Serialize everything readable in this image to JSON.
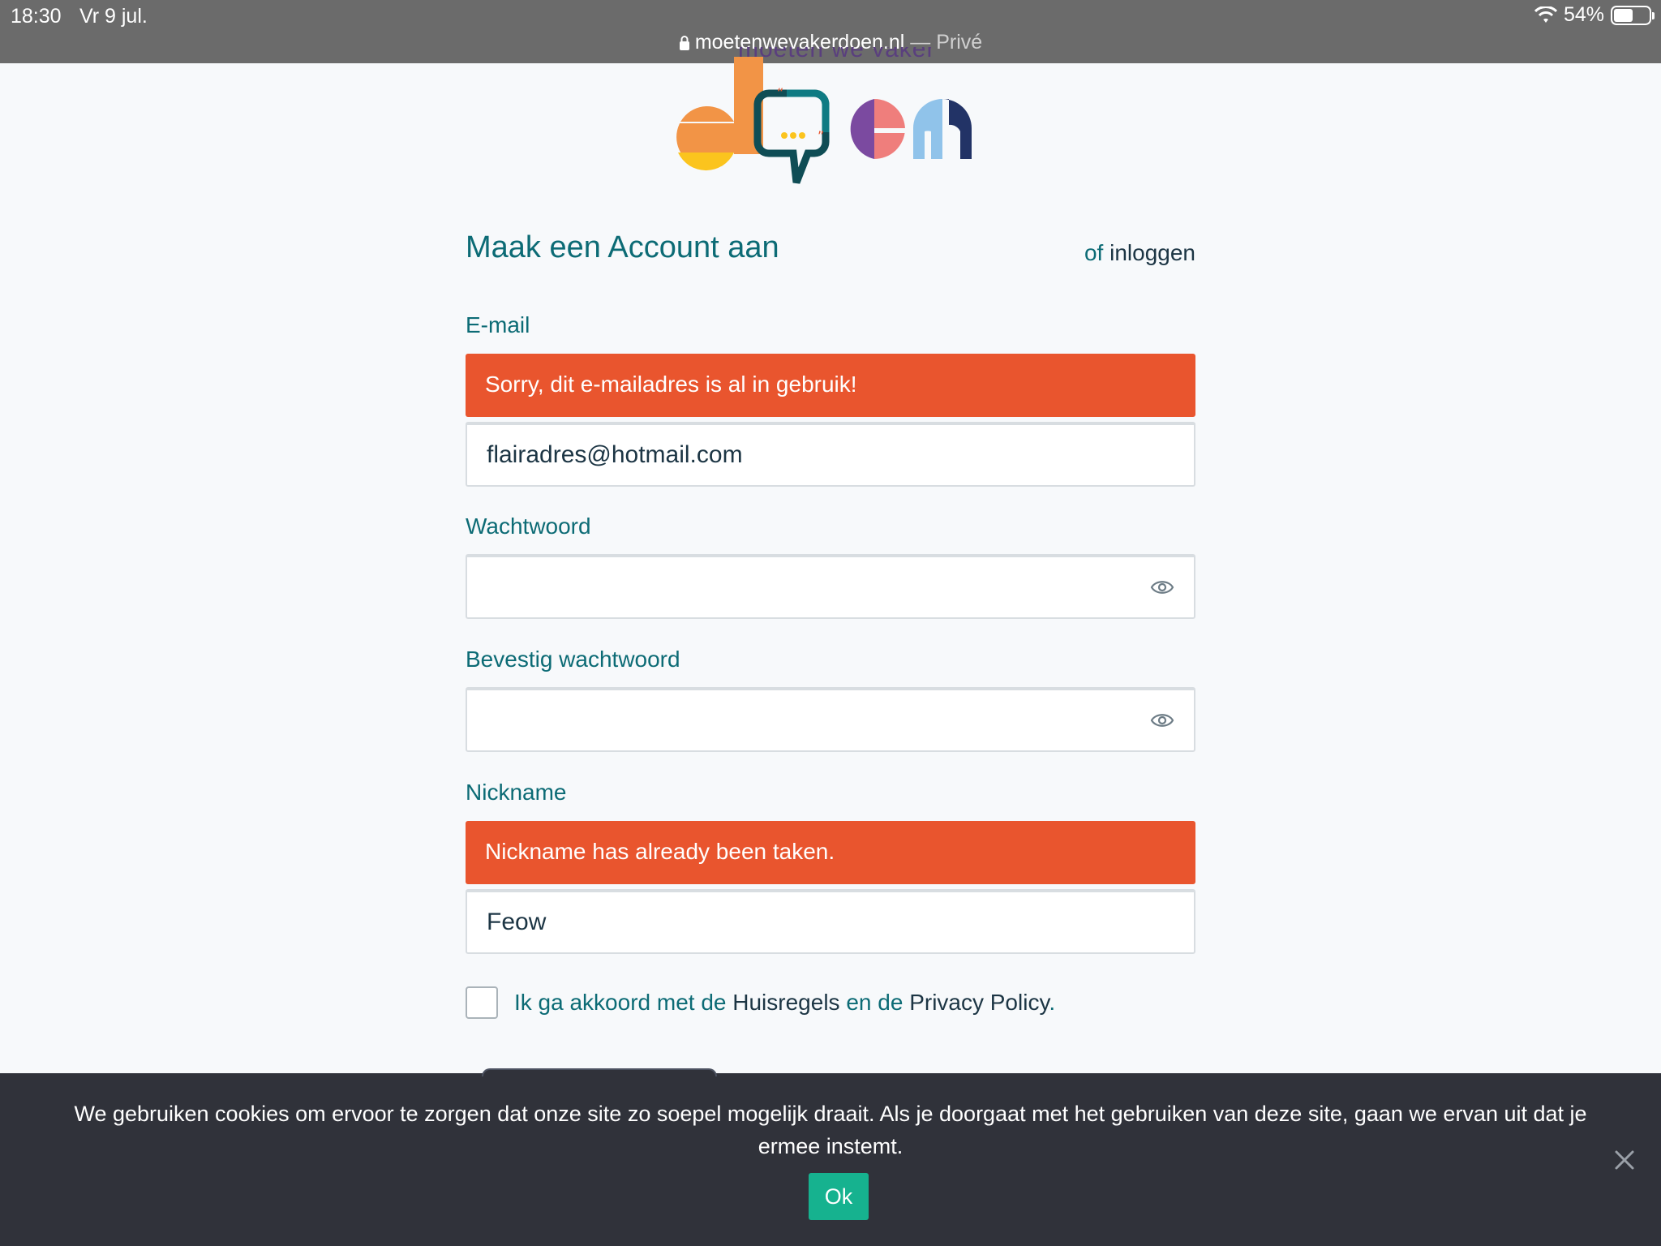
{
  "status_bar": {
    "time": "18:30",
    "date": "Vr 9 jul.",
    "battery": "54%",
    "battery_level": 0.54
  },
  "browser": {
    "url": "moetenwevakerdoen.nl",
    "separator": " — ",
    "mode": "Privé"
  },
  "logo": {
    "tagline": "moeten we vaker",
    "word": "doen"
  },
  "form": {
    "title": "Maak een Account aan",
    "alt_prefix": "of",
    "alt_link": "inloggen",
    "email": {
      "label": "E-mail",
      "error": "Sorry, dit e-mailadres is al in gebruik!",
      "value": "flairadres@hotmail.com"
    },
    "password": {
      "label": "Wachtwoord",
      "value": ""
    },
    "confirm_password": {
      "label": "Bevestig wachtwoord",
      "value": ""
    },
    "nickname": {
      "label": "Nickname",
      "error": "Nickname has already been taken.",
      "value": "Feow"
    },
    "agree": {
      "prefix": "Ik ga akkoord met de",
      "link1": "Huisregels",
      "middle": "en de",
      "link2": "Privacy Policy",
      "suffix": ".",
      "checked": false
    }
  },
  "cookie_banner": {
    "text": "We gebruiken cookies om ervoor te zorgen dat onze site zo soepel mogelijk draait. Als je doorgaat met het gebruiken van deze site, gaan we ervan uit dat je ermee instemt.",
    "ok_label": "Ok"
  },
  "colors": {
    "accent": "#0c6b75",
    "error": "#e9552e",
    "ok_button": "#16b28f",
    "banner": "#30323a"
  }
}
